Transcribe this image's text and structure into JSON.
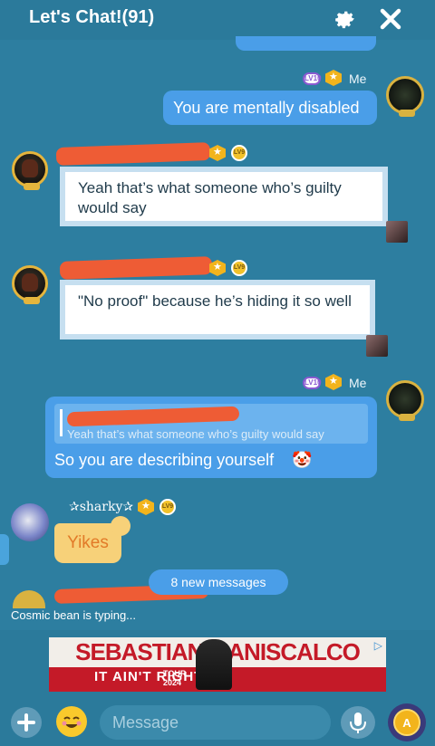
{
  "header": {
    "title": "Let's Chat!(91)",
    "settings_icon": "gear-icon",
    "close_icon": "close-icon"
  },
  "messages": [
    {
      "sender": "Me",
      "level": "LV10",
      "text": "You are mentally disabled",
      "side": "right"
    },
    {
      "sender_redacted": true,
      "level": "LV9",
      "text": "Yeah that’s what someone who’s guilty would say",
      "side": "left"
    },
    {
      "sender_redacted": true,
      "level": "LV9",
      "text": "\"No proof\" because he’s hiding it so well",
      "side": "left"
    },
    {
      "sender": "Me",
      "level": "LV10",
      "reply_quote": "Yeah that’s what someone who’s guilty would say",
      "text": "So you are describing yourself",
      "emoji": "🤡",
      "side": "right"
    },
    {
      "sender": "✰sharky✰",
      "level": "LV9",
      "text": "Yikes",
      "side": "left"
    }
  ],
  "new_messages": "8 new messages",
  "typing_status": "Cosmic bean is typing...",
  "ad": {
    "headline": "SEBASTIAN MANISCALCO",
    "subline": "IT AIN'T RIGHT",
    "tour": "TOUR",
    "year": "2024"
  },
  "composer": {
    "placeholder": "Message"
  },
  "colors": {
    "background": "#2d7ea0",
    "bubble_me": "#4a9ee8",
    "bubble_other": "#ffffff",
    "accent": "#f2c22b"
  }
}
